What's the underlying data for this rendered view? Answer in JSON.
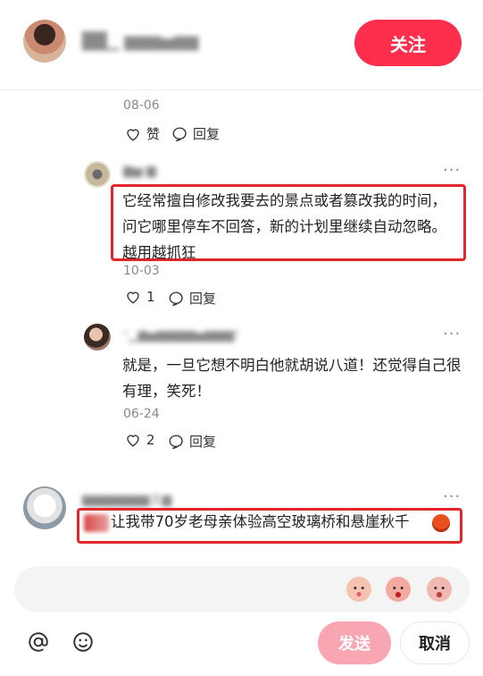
{
  "header": {
    "username": "██▁ ▆▆▆▅▆▆",
    "follow_label": "关注"
  },
  "comments": [
    {
      "date": "08-06",
      "like_label": "赞",
      "reply_label": "回复"
    },
    {
      "username": "▆▅·▆",
      "text": "它经常擅自修改我要去的景点或者篡改我的时间，问它哪里停车不回答，新的计划里继续自动忽略。越用越抓狂",
      "date": "10-03",
      "like_count": "1",
      "reply_label": "回复"
    },
    {
      "username": "ⁿ▁▆▅▆▆▆▆▅▆▆▆!",
      "text": "就是，一旦它想不明白他就胡说八道！还觉得自己很有理，笑死！",
      "date": "06-24",
      "like_count": "2",
      "reply_label": "回复"
    },
    {
      "username": "▆▆▆▆▆▆▆主▆",
      "text": "让我带70岁老母亲体验高空玻璃桥和悬崖秋千"
    }
  ],
  "more_label": "···",
  "input": {
    "emojis": [
      "smiling-face-emoji",
      "angry-face-emoji",
      "crying-face-emoji"
    ]
  },
  "toolbar": {
    "send_label": "发送",
    "cancel_label": "取消"
  },
  "colors": {
    "accent": "#ff2e4d",
    "send_disabled": "#f7a6b2",
    "highlight_box": "#e3262c"
  }
}
